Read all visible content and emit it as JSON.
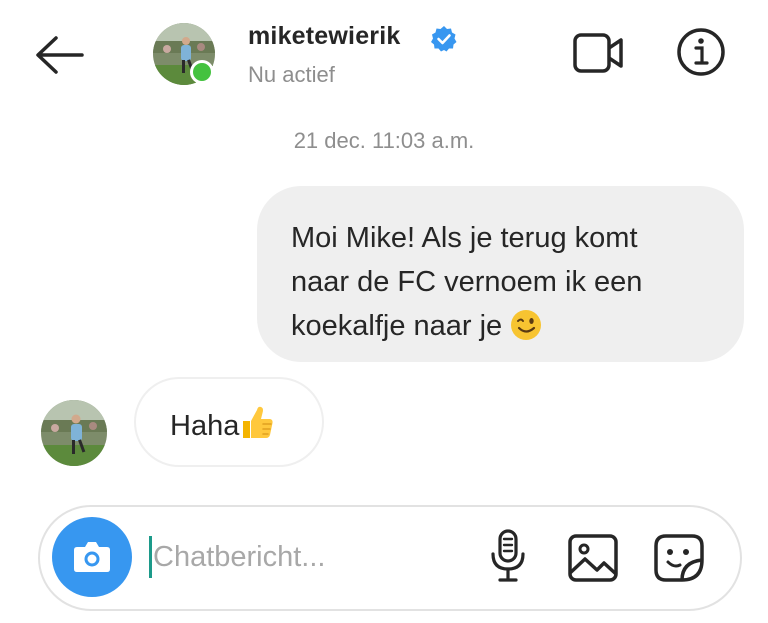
{
  "header": {
    "username": "miketewierik",
    "status": "Nu actief",
    "back_icon": "arrow-left-icon",
    "video_icon": "video-camera-icon",
    "info_icon": "info-icon",
    "verified_icon": "verified-badge-icon"
  },
  "conversation": {
    "timestamp": "21 dec. 11:03 a.m.",
    "messages": [
      {
        "sender": "me",
        "lines": [
          "Moi Mike! Als je terug komt",
          "naar de FC vernoem ik een",
          "koekalfje naar je"
        ],
        "emoji": "winking-face-icon"
      },
      {
        "sender": "miketewierik",
        "text": "Haha",
        "emoji": "thumbs-up-icon"
      }
    ]
  },
  "composer": {
    "placeholder": "Chatbericht...",
    "value": "",
    "camera_icon": "camera-icon",
    "mic_icon": "microphone-icon",
    "image_icon": "image-icon",
    "sticker_icon": "sticker-icon"
  },
  "colors": {
    "verified_blue": "#3897f0",
    "online_green": "#44c23f",
    "camera_blue": "#3797f0",
    "bubble_grey": "#efefef",
    "secondary_text": "#8e8e8e"
  }
}
